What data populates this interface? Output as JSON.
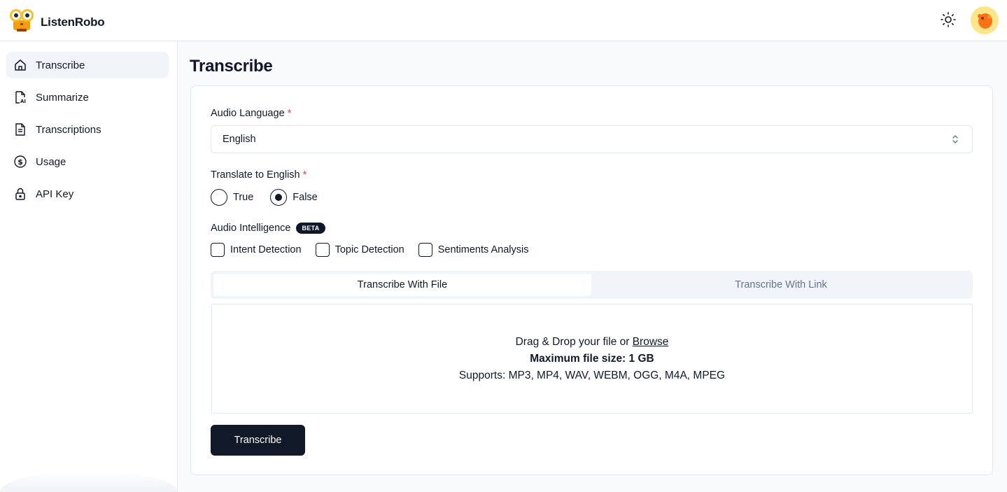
{
  "app": {
    "name": "ListenRobo"
  },
  "header": {
    "theme_icon": "sun-icon",
    "avatar_icon": "avatar"
  },
  "sidebar": {
    "items": [
      {
        "label": "Transcribe",
        "icon": "home-icon",
        "active": true
      },
      {
        "label": "Summarize",
        "icon": "ai-document-icon",
        "active": false
      },
      {
        "label": "Transcriptions",
        "icon": "document-icon",
        "active": false
      },
      {
        "label": "Usage",
        "icon": "dollar-icon",
        "active": false
      },
      {
        "label": "API Key",
        "icon": "lock-icon",
        "active": false
      }
    ]
  },
  "main": {
    "title": "Transcribe",
    "audio_language": {
      "label": "Audio Language",
      "required_mark": "*",
      "value": "English"
    },
    "translate": {
      "label": "Translate to English",
      "required_mark": "*",
      "options": [
        {
          "label": "True",
          "selected": false
        },
        {
          "label": "False",
          "selected": true
        }
      ]
    },
    "intelligence": {
      "label": "Audio Intelligence",
      "badge": "BETA",
      "options": [
        {
          "label": "Intent Detection",
          "checked": false
        },
        {
          "label": "Topic Detection",
          "checked": false
        },
        {
          "label": "Sentiments Analysis",
          "checked": false
        }
      ]
    },
    "tabs": [
      {
        "label": "Transcribe With File",
        "active": true
      },
      {
        "label": "Transcribe With Link",
        "active": false
      }
    ],
    "dropzone": {
      "prompt": "Drag & Drop your file or",
      "browse": "Browse",
      "max_size": "Maximum file size: 1 GB",
      "supports": "Supports: MP3, MP4, WAV, WEBM, OGG, M4A, MPEG"
    },
    "submit_label": "Transcribe"
  },
  "colors": {
    "primary": "#111827",
    "required": "#ef4444",
    "muted": "#64748b",
    "border": "#e2e8f0"
  }
}
